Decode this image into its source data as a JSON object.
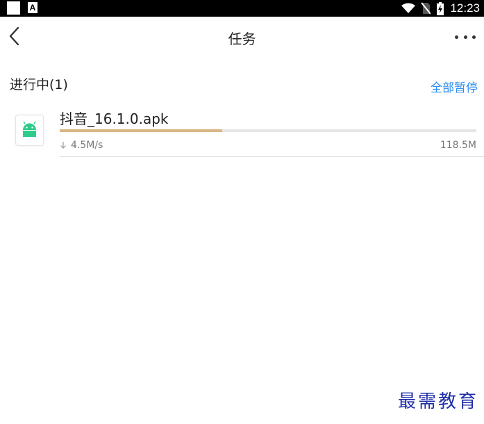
{
  "status_bar": {
    "time": "12:23",
    "notification_letter": "A"
  },
  "header": {
    "title": "任务"
  },
  "section": {
    "title": "进行中(1)",
    "pause_all_label": "全部暂停"
  },
  "downloads": [
    {
      "file_name": "抖音_16.1.0.apk",
      "speed": "4.5M/s",
      "size": "118.5M",
      "progress_percent": 39,
      "icon": "android-icon"
    }
  ],
  "watermark": "最需教育",
  "colors": {
    "accent": "#2b8ef1",
    "progress": "#d9b682",
    "app_icon": "#2ecc8a"
  }
}
